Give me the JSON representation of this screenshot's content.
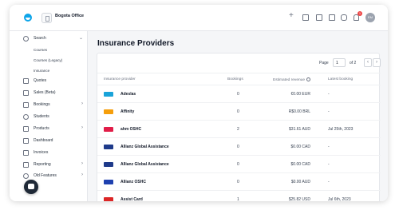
{
  "topbar": {
    "org_name": "Bogota Office",
    "notification_count": "1",
    "avatar_initials": "EM"
  },
  "sidebar": {
    "items": [
      {
        "label": "Search",
        "icon": "search-icon",
        "expanded": true
      },
      {
        "label": "Quotes",
        "icon": "quote-icon"
      },
      {
        "label": "Sales (Beta)",
        "icon": "sales-icon"
      },
      {
        "label": "Bookings",
        "icon": "bookings-icon",
        "chevron": true
      },
      {
        "label": "Students",
        "icon": "students-icon"
      },
      {
        "label": "Products",
        "icon": "tag-icon",
        "chevron": true
      },
      {
        "label": "Dashboard",
        "icon": "dashboard-icon"
      },
      {
        "label": "Invoices",
        "icon": "invoice-icon"
      },
      {
        "label": "Reporting",
        "icon": "chart-icon",
        "chevron": true
      },
      {
        "label": "Old Features",
        "icon": "info-icon",
        "chevron": true
      }
    ],
    "sub_items": [
      "Courses",
      "Courses (Legacy)",
      "Insurance"
    ]
  },
  "page": {
    "title": "Insurance Providers"
  },
  "pager": {
    "label": "Page",
    "current": "1",
    "of_text": "of 2"
  },
  "table": {
    "columns": [
      "Insurance provider",
      "Bookings",
      "Estimated revenue",
      "Latest booking"
    ],
    "rows": [
      {
        "name": "Adeslas",
        "bookings": "0",
        "revenue": "€0.00 EUR",
        "latest": "-",
        "logo_color": "#1aa3d9"
      },
      {
        "name": "Affinity",
        "bookings": "0",
        "revenue": "R$0.00 BRL",
        "latest": "-",
        "logo_color": "#f59e0b"
      },
      {
        "name": "ahm OSHC",
        "bookings": "2",
        "revenue": "$31.61 AUD",
        "latest": "Jul 25th, 2023",
        "logo_color": "#e11d48"
      },
      {
        "name": "Allianz Global Assistance",
        "bookings": "0",
        "revenue": "$0.00 CAD",
        "latest": "-",
        "logo_color": "#1e3a8a"
      },
      {
        "name": "Allianz Global Assistance",
        "bookings": "0",
        "revenue": "$0.00 CAD",
        "latest": "-",
        "logo_color": "#1e3a8a"
      },
      {
        "name": "Allianz OSHC",
        "bookings": "0",
        "revenue": "$0.00 AUD",
        "latest": "-",
        "logo_color": "#1e40af"
      },
      {
        "name": "Assist Card",
        "bookings": "1",
        "revenue": "$25.82 USD",
        "latest": "Jul 6th, 2023",
        "logo_color": "#dc2626"
      }
    ]
  }
}
